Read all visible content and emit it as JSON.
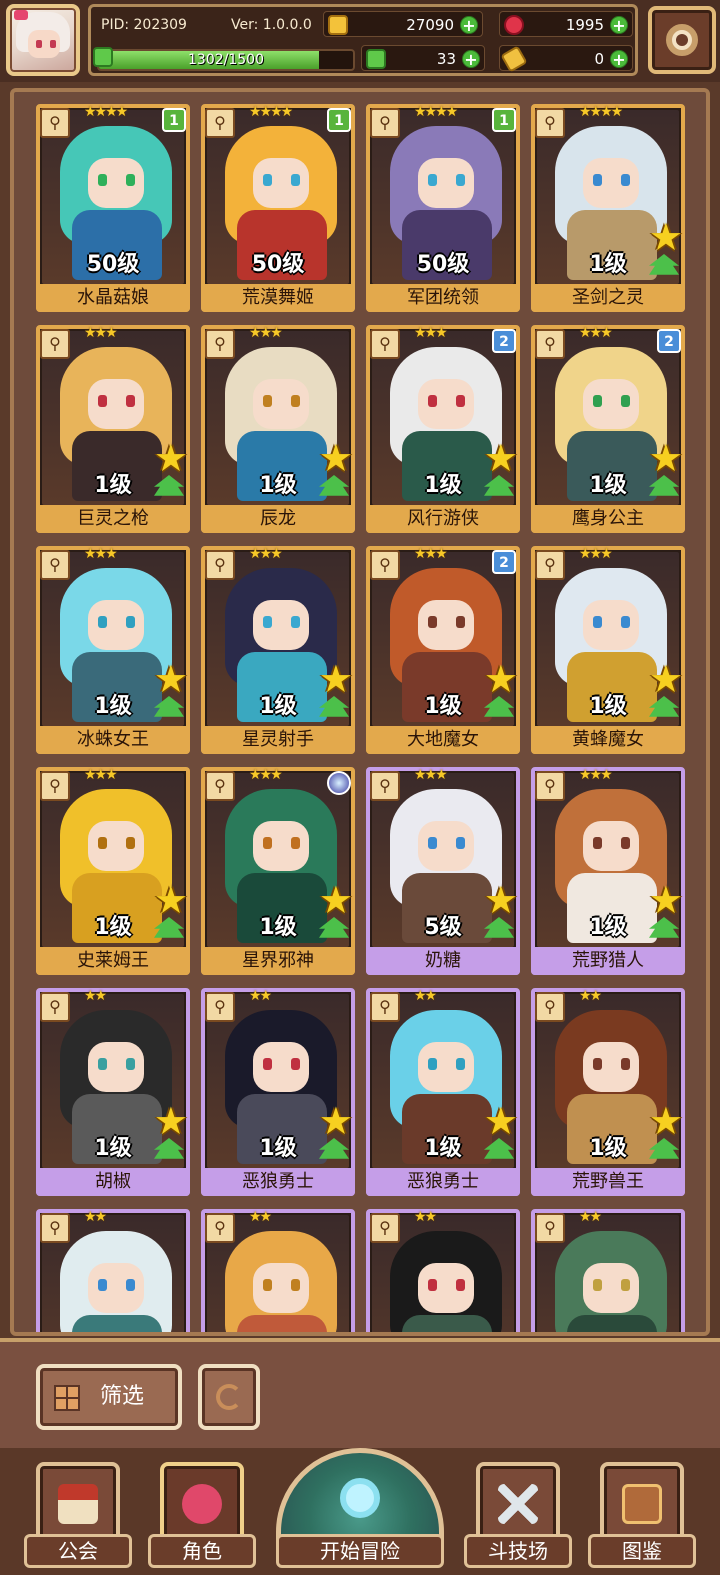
{
  "header": {
    "pid": "PID: 202309",
    "version": "Ver: 1.0.0.0",
    "exp": "1302/1500",
    "exp_fraction": 0.868,
    "resources": {
      "gold": "27090",
      "gem": "1995",
      "clover": "33",
      "ticket": "0"
    }
  },
  "characters": [
    {
      "name": "水晶菇娘",
      "level": "50级",
      "stars": "★★★★",
      "badge": "1",
      "badge_type": "green",
      "frame": "gold",
      "hair": "#46c7b7",
      "skin": "#2c6fa8",
      "eye": "#2fb05a"
    },
    {
      "name": "荒漠舞姬",
      "level": "50级",
      "stars": "★★★★",
      "badge": "1",
      "badge_type": "green",
      "frame": "gold",
      "hair": "#f3b23a",
      "skin": "#b8342c",
      "eye": "#3aa8d0"
    },
    {
      "name": "军团统领",
      "level": "50级",
      "stars": "★★★★",
      "badge": "1",
      "badge_type": "green",
      "frame": "gold",
      "hair": "#8a7ab8",
      "skin": "#4a3a6a",
      "eye": "#3aa8d0"
    },
    {
      "name": "圣剑之灵",
      "level": "1级",
      "stars": "★★★★",
      "badge": "",
      "badge_type": "",
      "frame": "gold",
      "hair": "#d8e4ec",
      "skin": "#b89a6a",
      "eye": "#3a8ad0"
    },
    {
      "name": "巨灵之枪",
      "level": "1级",
      "stars": "★★★",
      "badge": "",
      "badge_type": "",
      "frame": "gold",
      "hair": "#e8b45a",
      "skin": "#3a2a2a",
      "eye": "#c03040"
    },
    {
      "name": "辰龙",
      "level": "1级",
      "stars": "★★★",
      "badge": "",
      "badge_type": "",
      "frame": "gold",
      "hair": "#e8dcc2",
      "skin": "#2a7aa8",
      "eye": "#c08020"
    },
    {
      "name": "风行游侠",
      "level": "1级",
      "stars": "★★★",
      "badge": "2",
      "badge_type": "blue",
      "frame": "gold",
      "hair": "#eaeaea",
      "skin": "#2a5a4a",
      "eye": "#c03040"
    },
    {
      "name": "鹰身公主",
      "level": "1级",
      "stars": "★★★",
      "badge": "2",
      "badge_type": "blue",
      "frame": "gold",
      "hair": "#f0d48a",
      "skin": "#3a5a5a",
      "eye": "#30a050"
    },
    {
      "name": "冰蛛女王",
      "level": "1级",
      "stars": "★★★",
      "badge": "",
      "badge_type": "",
      "frame": "gold",
      "hair": "#7ad8e8",
      "skin": "#3a6a7a",
      "eye": "#30a0c0"
    },
    {
      "name": "星灵射手",
      "level": "1级",
      "stars": "★★★",
      "badge": "",
      "badge_type": "",
      "frame": "gold",
      "hair": "#2a2a4a",
      "skin": "#3aa8c0",
      "eye": "#3aa8d0"
    },
    {
      "name": "大地魔女",
      "level": "1级",
      "stars": "★★★",
      "badge": "2",
      "badge_type": "blue",
      "frame": "gold",
      "hair": "#c05a2a",
      "skin": "#7a3a2a",
      "eye": "#7a3a2a"
    },
    {
      "name": "黄蜂魔女",
      "level": "1级",
      "stars": "★★★",
      "badge": "",
      "badge_type": "",
      "frame": "gold",
      "hair": "#dfe8f0",
      "skin": "#d0a030",
      "eye": "#3a8ad0"
    },
    {
      "name": "史莱姆王",
      "level": "1级",
      "stars": "★★★",
      "badge": "",
      "badge_type": "",
      "frame": "gold",
      "hair": "#f0c02a",
      "skin": "#d8a020",
      "eye": "#b07010"
    },
    {
      "name": "星界邪神",
      "level": "1级",
      "stars": "★★★",
      "badge": "",
      "badge_type": "orb",
      "frame": "gold",
      "hair": "#2a7a5a",
      "skin": "#1a4a3a",
      "eye": "#c07020"
    },
    {
      "name": "奶糖",
      "level": "5级",
      "stars": "★★★",
      "badge": "",
      "badge_type": "",
      "frame": "purple",
      "hair": "#eaeaf0",
      "skin": "#6a4a3a",
      "eye": "#3a8ad0"
    },
    {
      "name": "荒野猎人",
      "level": "1级",
      "stars": "★★★",
      "badge": "",
      "badge_type": "",
      "frame": "purple",
      "hair": "#c0703a",
      "skin": "#f0e8e0",
      "eye": "#7a3a2a"
    },
    {
      "name": "胡椒",
      "level": "1级",
      "stars": "★★",
      "badge": "",
      "badge_type": "",
      "frame": "purple",
      "hair": "#2a2a2a",
      "skin": "#5a5a5a",
      "eye": "#3aa0a0"
    },
    {
      "name": "恶狼勇士",
      "level": "1级",
      "stars": "★★",
      "badge": "",
      "badge_type": "",
      "frame": "purple",
      "hair": "#1a1a2a",
      "skin": "#4a4a5a",
      "eye": "#c03040"
    },
    {
      "name": "恶狼勇士",
      "level": "1级",
      "stars": "★★",
      "badge": "",
      "badge_type": "",
      "frame": "purple",
      "hair": "#6ad0e8",
      "skin": "#6a3a2a",
      "eye": "#30a0c0"
    },
    {
      "name": "荒野兽王",
      "level": "1级",
      "stars": "★★",
      "badge": "",
      "badge_type": "",
      "frame": "purple",
      "hair": "#7a3a20",
      "skin": "#c09050",
      "eye": "#7a3a2a"
    },
    {
      "name": "",
      "level": "",
      "stars": "★★",
      "badge": "",
      "badge_type": "",
      "frame": "purple",
      "hair": "#e0ecef",
      "skin": "#3a7a7a",
      "eye": "#3a8ad0"
    },
    {
      "name": "",
      "level": "",
      "stars": "★★",
      "badge": "",
      "badge_type": "",
      "frame": "purple",
      "hair": "#e8a848",
      "skin": "#c05a3a",
      "eye": "#c08020"
    },
    {
      "name": "",
      "level": "",
      "stars": "★★",
      "badge": "",
      "badge_type": "",
      "frame": "purple",
      "hair": "#1a1a1a",
      "skin": "#3a5a4a",
      "eye": "#c03040"
    },
    {
      "name": "",
      "level": "",
      "stars": "★★",
      "badge": "",
      "badge_type": "",
      "frame": "purple",
      "hair": "#4a7a5a",
      "skin": "#2a4a3a",
      "eye": "#c0a040"
    }
  ],
  "filter": {
    "filter_label": "筛选"
  },
  "nav": {
    "guild": "公会",
    "character": "角色",
    "adventure": "开始冒险",
    "arena": "斗技场",
    "codex": "图鉴"
  }
}
